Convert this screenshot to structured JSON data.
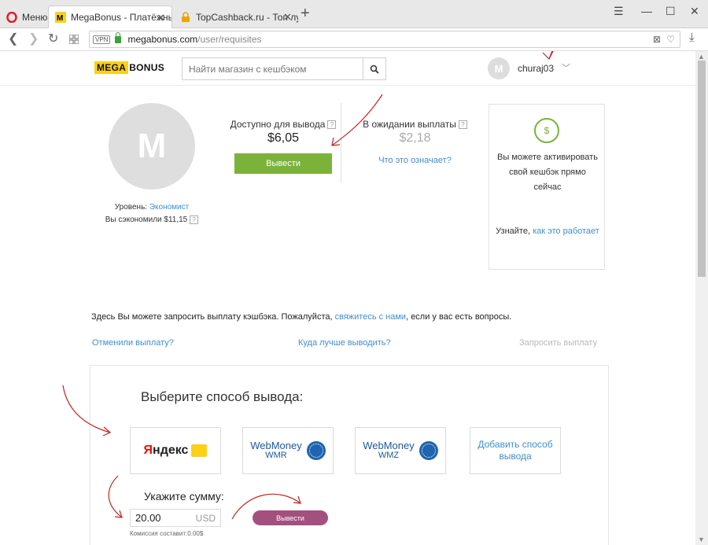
{
  "browser": {
    "menu_label": "Меню",
    "tabs": [
      {
        "title": "MegaBonus - Платёжные"
      },
      {
        "title": "TopCashback.ru - Топ луч"
      }
    ],
    "url_host": "megabonus.com",
    "url_path": "/user/requisites",
    "vpn_label": "VPN"
  },
  "header": {
    "logo_mega": "MEGA",
    "logo_bonus": "BONUS",
    "search_placeholder": "Найти магазин с кешбэком",
    "user_initial": "M",
    "username": "churaj03"
  },
  "profile": {
    "avatar_initial": "M",
    "level_label": "Уровень:",
    "level_value": "Экономист",
    "saved_label": "Вы сэкономили $11,15",
    "available_label": "Доступно для вывода",
    "available_value": "$6,05",
    "withdraw_label": "Вывести",
    "pending_label": "В ожидании выплаты",
    "pending_value": "$2,18",
    "what_means": "Что это означает?",
    "q_mark": "?"
  },
  "promo": {
    "icon": "$",
    "text": "Вы можете активировать свой кешбэк прямо сейчас",
    "learn_prefix": "Узнайте,",
    "learn_link": "как это работает"
  },
  "info": {
    "text_before": "Здесь Вы можете запросить выплату кэшбэка. Пожалуйста,",
    "link": "свяжитесь с нами",
    "text_after": ", если у вас есть вопросы.",
    "cancelled": "Отменили выплату?",
    "where": "Куда лучше выводить?",
    "request": "Запросить выплату"
  },
  "methods": {
    "title": "Выберите способ вывода:",
    "yandex_first": "Я",
    "yandex_rest": "ндекс",
    "wmr_line1": "WebMoney",
    "wmr_line2": "WMR",
    "wmz_line1": "WebMoney",
    "wmz_line2": "WMZ",
    "add": "Добавить способ вывода",
    "amount_title": "Укажите сумму:",
    "amount_value": "20.00",
    "currency": "USD",
    "withdraw_label": "Вывести",
    "commission": "Комиссия составит:0.00$"
  }
}
